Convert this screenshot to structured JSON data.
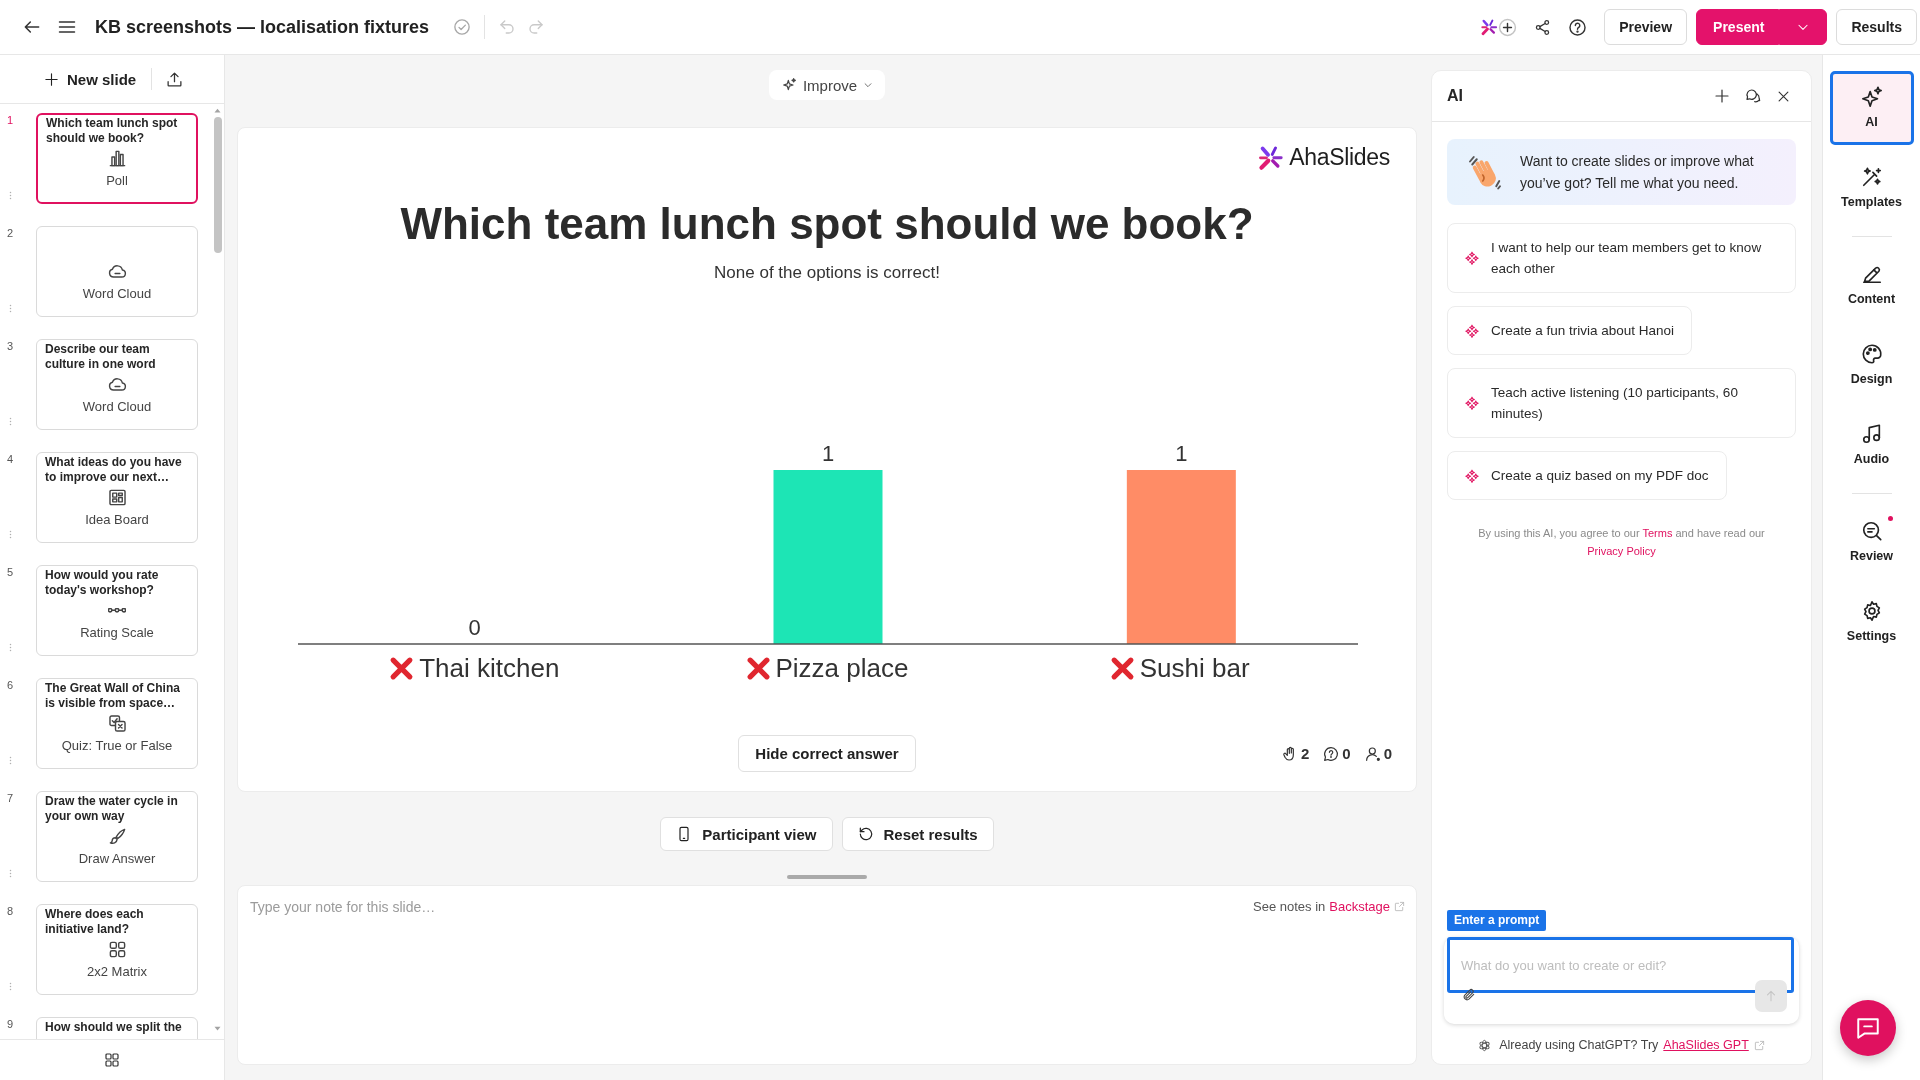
{
  "top_bar": {
    "title": "KB screenshots — localisation fixtures",
    "history": [
      {
        "kind": "undo",
        "disabled": true
      },
      {
        "kind": "redo",
        "disabled": true
      }
    ],
    "buttons": [
      {
        "kind": "secondary",
        "label": "Preview",
        "dropdown": false
      },
      {
        "kind": "primary",
        "label": "Present",
        "dropdown": true
      },
      {
        "kind": "secondary",
        "label": "Results",
        "dropdown": false
      }
    ]
  },
  "sidebar": {
    "new_slide": "New slide",
    "slides": [
      {
        "number": "1",
        "title": "Which team lunch spot should we book?",
        "kind": "poll",
        "type": "Poll",
        "selected": true
      },
      {
        "number": "2",
        "kind": "word_cloud",
        "type": "Word Cloud",
        "selected": false
      },
      {
        "number": "3",
        "title": "Describe our team culture in one word",
        "kind": "word_cloud",
        "type": "Word Cloud",
        "selected": false
      },
      {
        "number": "4",
        "title": "What ideas do you have to improve our next…",
        "kind": "idea_board",
        "type": "Idea Board",
        "selected": false
      },
      {
        "number": "5",
        "title": "How would you rate today's workshop?",
        "kind": "rating_scale",
        "type": "Rating Scale",
        "selected": false
      },
      {
        "number": "6",
        "title": "The Great Wall of China is visible from space…",
        "kind": "true_false",
        "type": "Quiz: True or False",
        "selected": false
      },
      {
        "number": "7",
        "title": "Draw the water cycle in your own way",
        "kind": "draw",
        "type": "Draw Answer",
        "selected": false
      },
      {
        "number": "8",
        "title": "Where does each initiative land?",
        "kind": "matrix",
        "type": "2x2 Matrix",
        "selected": false
      },
      {
        "number": "9",
        "title": "How should we split the",
        "selected": false
      }
    ]
  },
  "editor": {
    "improve": "Improve",
    "slide": {
      "logo": "AhaSlides",
      "title": "Which team lunch spot should we book?",
      "subtitle": "None of the options is correct!",
      "chart_data": {
        "type": "bar",
        "categories": [
          "Thai kitchen",
          "Pizza place",
          "Sushi bar"
        ],
        "values": [
          0,
          1,
          1
        ],
        "colors": [
          null,
          "#1de5b5",
          "#ff8c66"
        ],
        "data_labels": true
      },
      "options": [
        {
          "correct": false
        },
        {
          "correct": false
        },
        {
          "correct": false
        }
      ],
      "answer_toggle": "Hide correct answer",
      "stats": [
        {
          "kind": "reactions",
          "value": "2"
        },
        {
          "kind": "responses",
          "value": "0"
        },
        {
          "kind": "participants",
          "value": "0"
        }
      ]
    },
    "actions": [
      {
        "kind": "participant_view",
        "label": "Participant view"
      },
      {
        "kind": "reset",
        "label": "Reset results"
      }
    ],
    "notes": {
      "placeholder": "Type your note for this slide…",
      "hint": "See notes in",
      "link": "Backstage"
    }
  },
  "ai_panel": {
    "title": "AI",
    "welcome": "Want to create slides or improve what you’ve got? Tell me what you need.",
    "suggestions": [
      "I want to help our team members get to know each other",
      "Create a fun trivia about Hanoi",
      "Teach active listening (10 participants, 60 minutes)",
      "Create a quiz based on my PDF doc"
    ],
    "disclaimer": {
      "before": "By using this AI, you agree to our",
      "terms": "Terms",
      "middle": "and have read our",
      "privacy": "Privacy Policy"
    },
    "prompt": {
      "label": "Enter a prompt",
      "placeholder": "What do you want to create or edit?",
      "send_disabled": true
    },
    "footer": {
      "text": "Already using ChatGPT? Try",
      "link": "AhaSlides GPT"
    }
  },
  "rail": {
    "groups": [
      [
        {
          "kind": "ai",
          "label": "AI",
          "selected": true,
          "notification": false
        },
        {
          "kind": "templates",
          "label": "Templates",
          "selected": false,
          "notification": false
        }
      ],
      [
        {
          "kind": "content",
          "label": "Content",
          "selected": false,
          "notification": false
        },
        {
          "kind": "design",
          "label": "Design",
          "selected": false,
          "notification": false
        },
        {
          "kind": "audio",
          "label": "Audio",
          "selected": false,
          "notification": false
        }
      ],
      [
        {
          "kind": "review",
          "label": "Review",
          "selected": false,
          "notification": true
        },
        {
          "kind": "settings",
          "label": "Settings",
          "selected": false,
          "notification": false
        }
      ]
    ]
  }
}
